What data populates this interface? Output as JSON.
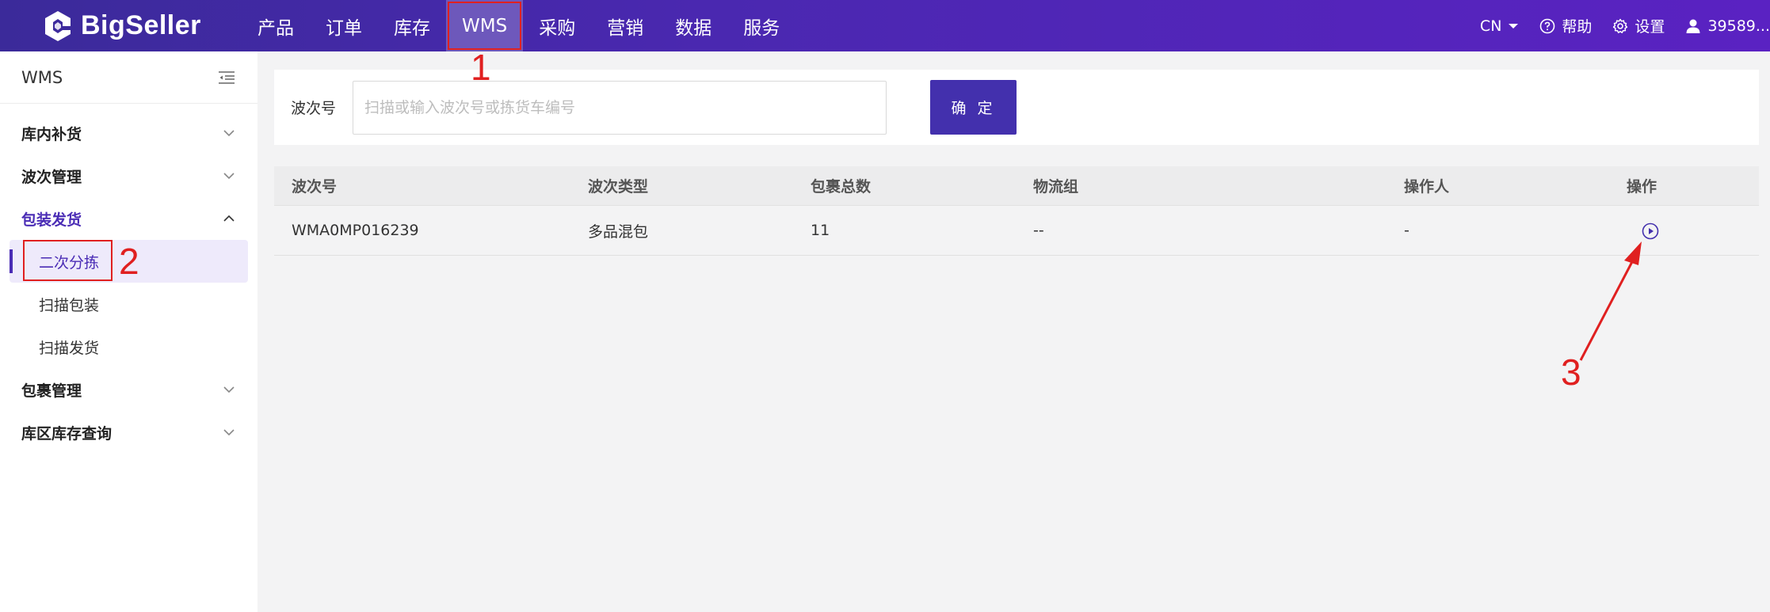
{
  "brand": {
    "name": "BigSeller"
  },
  "nav": {
    "items": [
      {
        "label": "产品"
      },
      {
        "label": "订单"
      },
      {
        "label": "库存"
      },
      {
        "label": "WMS"
      },
      {
        "label": "采购"
      },
      {
        "label": "营销"
      },
      {
        "label": "数据"
      },
      {
        "label": "服务"
      }
    ],
    "active_index": 3
  },
  "topbar_right": {
    "lang": "CN",
    "help": "帮助",
    "settings": "设置",
    "user": "39589..."
  },
  "sidebar": {
    "title": "WMS",
    "groups": [
      {
        "label": "库内补货"
      },
      {
        "label": "波次管理"
      },
      {
        "label": "包装发货"
      },
      {
        "label": "包裹管理"
      },
      {
        "label": "库区库存查询"
      }
    ],
    "sub_items": [
      {
        "label": "二次分拣"
      },
      {
        "label": "扫描包装"
      },
      {
        "label": "扫描发货"
      }
    ]
  },
  "search": {
    "label": "波次号",
    "placeholder": "扫描或输入波次号或拣货车编号",
    "value": "",
    "confirm_label": "确 定"
  },
  "table": {
    "columns": [
      "波次号",
      "波次类型",
      "包裹总数",
      "物流组",
      "操作人",
      "操作"
    ],
    "rows": [
      {
        "wave_no": "WMA0MP016239",
        "wave_type": "多品混包",
        "package_total": "11",
        "logistics_group": "--",
        "operator": "-"
      }
    ]
  },
  "annotations": {
    "a1": "1",
    "a2": "2",
    "a3": "3"
  },
  "colors": {
    "accent": "#4330ad",
    "annotation": "#e02020"
  }
}
